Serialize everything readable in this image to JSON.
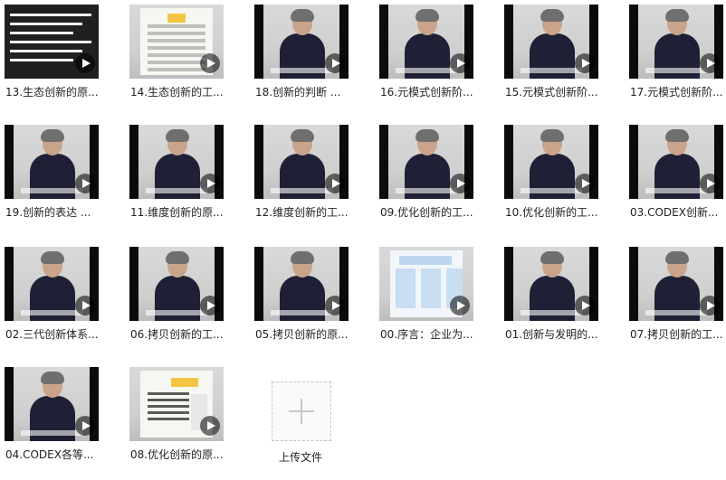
{
  "items": [
    {
      "caption": "13.生态创新的原...",
      "kind": "text"
    },
    {
      "caption": "14.生态创新的工...",
      "kind": "slide"
    },
    {
      "caption": "18.创新的判断  ...",
      "kind": "person"
    },
    {
      "caption": "16.元模式创新阶...",
      "kind": "person"
    },
    {
      "caption": "15.元模式创新阶...",
      "kind": "person"
    },
    {
      "caption": "17.元模式创新阶...",
      "kind": "person"
    },
    {
      "caption": "19.创新的表达  ...",
      "kind": "person"
    },
    {
      "caption": "11.维度创新的原...",
      "kind": "person"
    },
    {
      "caption": "12.维度创新的工...",
      "kind": "person"
    },
    {
      "caption": "09.优化创新的工...",
      "kind": "person"
    },
    {
      "caption": "10.优化创新的工...",
      "kind": "person"
    },
    {
      "caption": "03.CODEX创新...",
      "kind": "person"
    },
    {
      "caption": "02.三代创新体系...",
      "kind": "person"
    },
    {
      "caption": "06.拷贝创新的工...",
      "kind": "person"
    },
    {
      "caption": "05.拷贝创新的原...",
      "kind": "person"
    },
    {
      "caption": "00.序言：企业为...",
      "kind": "slide2"
    },
    {
      "caption": "01.创新与发明的...",
      "kind": "person"
    },
    {
      "caption": "07.拷贝创新的工...",
      "kind": "person"
    },
    {
      "caption": "04.CODEX各等...",
      "kind": "person"
    },
    {
      "caption": "08.优化创新的原...",
      "kind": "slide3"
    }
  ],
  "upload": {
    "label": "上传文件"
  }
}
